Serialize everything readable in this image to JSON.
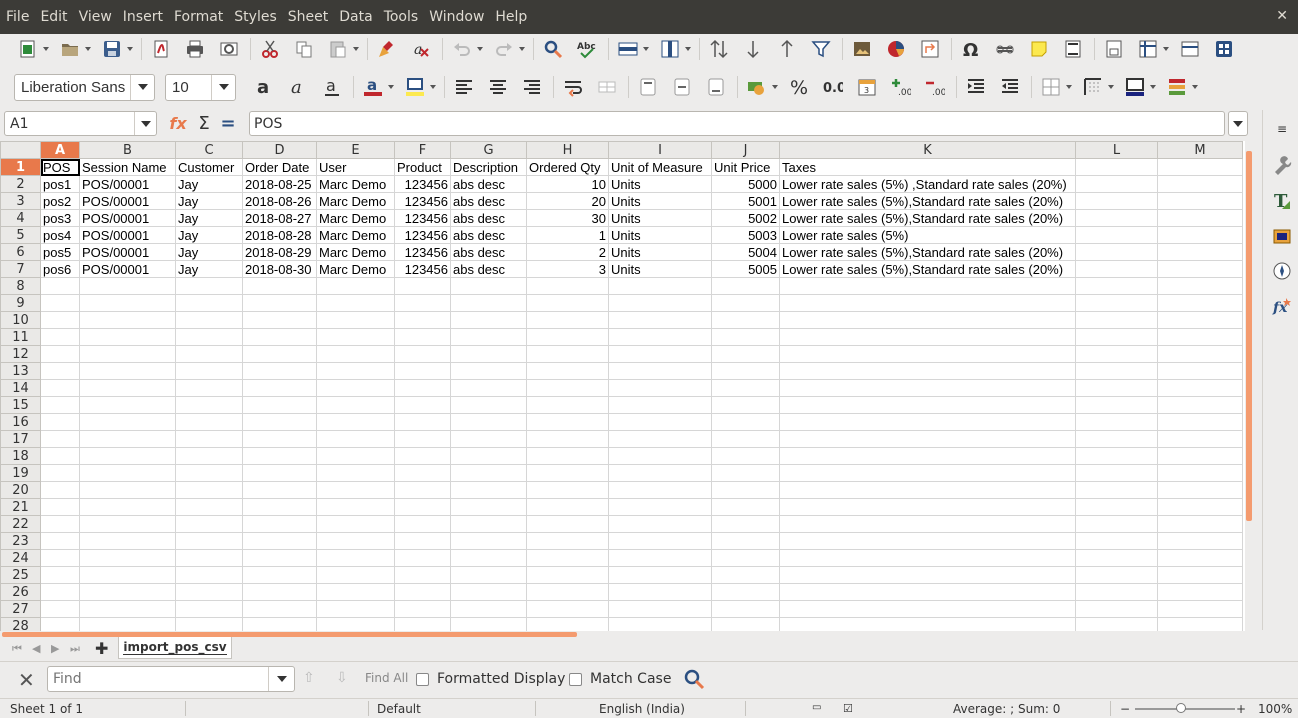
{
  "menu": [
    "File",
    "Edit",
    "View",
    "Insert",
    "Format",
    "Styles",
    "Sheet",
    "Data",
    "Tools",
    "Window",
    "Help"
  ],
  "format": {
    "font_name": "Liberation Sans",
    "font_size": "10"
  },
  "formula": {
    "cell_ref": "A1",
    "content": "POS"
  },
  "columns": [
    {
      "letter": "A",
      "width": 39
    },
    {
      "letter": "B",
      "width": 96
    },
    {
      "letter": "C",
      "width": 67
    },
    {
      "letter": "D",
      "width": 74
    },
    {
      "letter": "E",
      "width": 78
    },
    {
      "letter": "F",
      "width": 56
    },
    {
      "letter": "G",
      "width": 76
    },
    {
      "letter": "H",
      "width": 82
    },
    {
      "letter": "I",
      "width": 103
    },
    {
      "letter": "J",
      "width": 68
    },
    {
      "letter": "K",
      "width": 296
    },
    {
      "letter": "L",
      "width": 82
    },
    {
      "letter": "M",
      "width": 85
    }
  ],
  "rows": [
    [
      "POS",
      "Session Name",
      "Customer",
      "Order Date",
      "User",
      "Product",
      "Description",
      "Ordered Qty",
      "Unit of Measure",
      "Unit Price",
      "Taxes",
      "",
      ""
    ],
    [
      "pos1",
      "POS/00001",
      "Jay",
      "2018-08-25",
      "Marc Demo",
      "123456",
      "abs desc",
      "10",
      "Units",
      "5000",
      "Lower rate sales (5%) ,Standard rate sales (20%)",
      "",
      ""
    ],
    [
      "pos2",
      "POS/00001",
      "Jay",
      "2018-08-26",
      "Marc Demo",
      "123456",
      "abs desc",
      "20",
      "Units",
      "5001",
      "Lower rate sales (5%),Standard rate sales (20%)",
      "",
      ""
    ],
    [
      "pos3",
      "POS/00001",
      "Jay",
      "2018-08-27",
      "Marc Demo",
      "123456",
      "abs desc",
      "30",
      "Units",
      "5002",
      "Lower rate sales (5%),Standard rate sales (20%)",
      "",
      ""
    ],
    [
      "pos4",
      "POS/00001",
      "Jay",
      "2018-08-28",
      "Marc Demo",
      "123456",
      "abs desc",
      "1",
      "Units",
      "5003",
      "Lower rate sales (5%)",
      "",
      ""
    ],
    [
      "pos5",
      "POS/00001",
      "Jay",
      "2018-08-29",
      "Marc Demo",
      "123456",
      "abs desc",
      "2",
      "Units",
      "5004",
      "Lower rate sales (5%),Standard rate sales (20%)",
      "",
      ""
    ],
    [
      "pos6",
      "POS/00001",
      "Jay",
      "2018-08-30",
      "Marc Demo",
      "123456",
      "abs desc",
      "3",
      "Units",
      "5005",
      "Lower rate sales (5%),Standard rate sales (20%)",
      "",
      ""
    ]
  ],
  "numeric_columns": [
    5,
    7,
    9
  ],
  "total_rows": 28,
  "sheet_tab": "import_pos_csv",
  "find": {
    "placeholder": "Find",
    "find_all": "Find All",
    "formatted_display": "Formatted Display",
    "match_case": "Match Case"
  },
  "status": {
    "sheet": "Sheet 1 of 1",
    "style": "Default",
    "language": "English (India)",
    "summary": "Average: ; Sum: 0",
    "zoom": "100%",
    "zoom_minus": "−",
    "zoom_plus": "+"
  }
}
